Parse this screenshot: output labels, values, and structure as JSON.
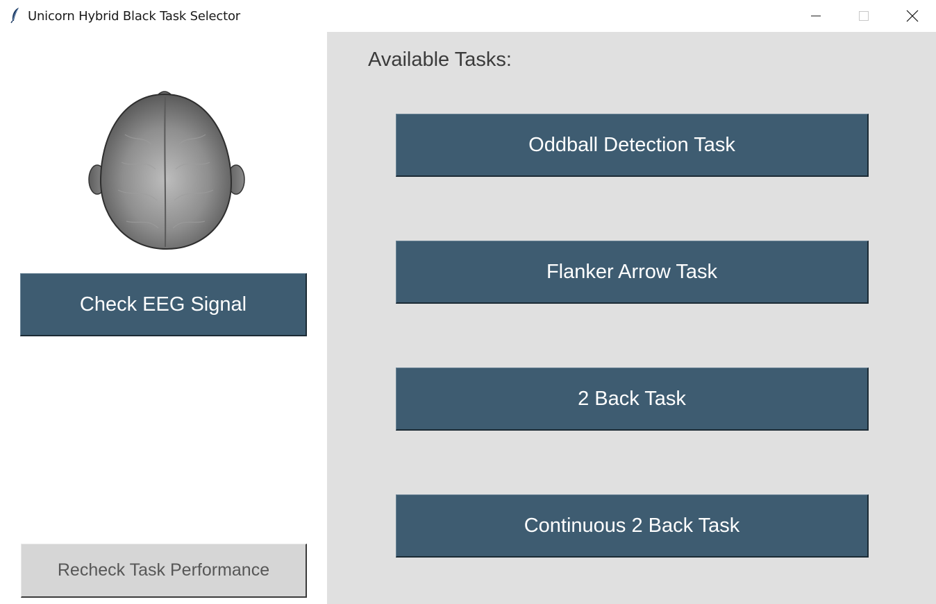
{
  "window": {
    "title": "Unicorn Hybrid Black Task Selector",
    "app_icon": "feather-icon",
    "controls": {
      "minimize_icon": "minimize-icon",
      "maximize_icon": "maximize-icon",
      "close_icon": "close-icon"
    }
  },
  "left": {
    "head_image": "head-top-view-image",
    "check_eeg_label": "Check EEG Signal",
    "recheck_label": "Recheck Task Performance"
  },
  "right": {
    "heading": "Available Tasks:",
    "tasks": [
      {
        "label": "Oddball Detection Task"
      },
      {
        "label": "Flanker Arrow Task"
      },
      {
        "label": "2 Back Task"
      },
      {
        "label": "Continuous 2 Back Task"
      }
    ]
  },
  "colors": {
    "button_bg": "#3e5c71",
    "button_text": "#ffffff",
    "panel_bg": "#e0e0e0",
    "disabled_bg": "#d6d6d6",
    "disabled_text": "#575757"
  }
}
